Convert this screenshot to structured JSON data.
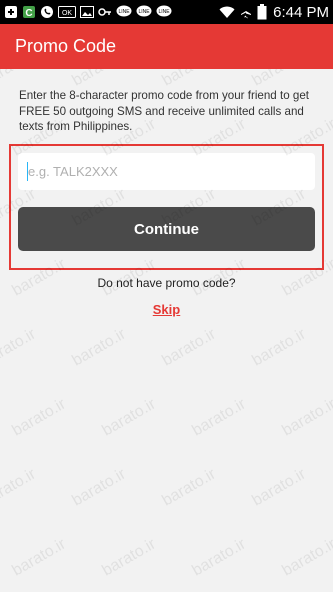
{
  "status_bar": {
    "time": "6:44 PM",
    "icons": [
      "plus-icon",
      "app-c-icon",
      "phone-icon",
      "alert-icon",
      "image-icon",
      "key-icon",
      "line-icon",
      "line-icon",
      "line-icon",
      "wifi-icon",
      "airplane-icon",
      "battery-icon"
    ]
  },
  "app_bar": {
    "title": "Promo Code",
    "color": "#e53935"
  },
  "main": {
    "description": "Enter the 8-character promo code from your friend to get FREE 50 outgoing SMS and receive unlimited calls and texts from Philippines.",
    "promo_input": {
      "value": "",
      "placeholder": "e.g. TALK2XXX"
    },
    "continue_label": "Continue",
    "no_promo_text": "Do not have promo code?",
    "skip_label": "Skip"
  },
  "watermark": {
    "text": "barato.ir"
  }
}
